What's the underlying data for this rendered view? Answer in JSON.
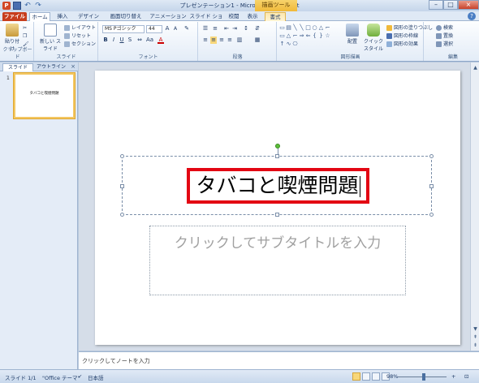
{
  "window": {
    "title": "プレゼンテーション1 - Microsoft PowerPoint",
    "context_tab_title": "描画ツール",
    "help": "?"
  },
  "qat": {
    "app_icon": "P",
    "undo": "↶",
    "redo": "↷"
  },
  "tabs": {
    "file": "ファイル",
    "home": "ホーム",
    "insert": "挿入",
    "design": "デザイン",
    "transitions": "画面切り替え",
    "animations": "アニメーション",
    "slideshow": "スライド ショー",
    "review": "校閲",
    "view": "表示",
    "format": "書式"
  },
  "ribbon": {
    "clipboard": {
      "paste": "貼り付け",
      "label": "クリップボード"
    },
    "slides": {
      "new_slide": "新しい スライド",
      "layout": "レイアウト",
      "reset": "リセット",
      "section": "セクション",
      "label": "スライド"
    },
    "font": {
      "name": "MS Pゴシック",
      "size": "44",
      "bold": "B",
      "italic": "I",
      "underline": "U",
      "strike": "S",
      "grow": "A",
      "shrink": "A",
      "color": "A",
      "label": "フォント"
    },
    "paragraph": {
      "label": "段落"
    },
    "drawing": {
      "arrange": "配置",
      "quick_styles": "クイック スタイル",
      "fill": "図形の塗りつぶし",
      "outline": "図形の枠線",
      "effects": "図形の効果",
      "label": "図形描画"
    },
    "editing": {
      "find": "検索",
      "replace": "置換",
      "select": "選択",
      "label": "編集"
    }
  },
  "left_pane": {
    "tab_slides": "スライド",
    "tab_outline": "アウトライン",
    "close": "×",
    "slide_number": "1",
    "thumb_title": "タバコと喫煙問題"
  },
  "slide": {
    "title": "タバコと喫煙問題",
    "subtitle_placeholder": "クリックしてサブタイトルを入力"
  },
  "notes": {
    "placeholder": "クリックしてノートを入力"
  },
  "status": {
    "slide_info": "スライド 1/1",
    "theme": "\"Office テーマ\"",
    "language": "日本語",
    "zoom": "98%"
  },
  "colors": {
    "file_tab": "#c73e1d",
    "highlight": "#e30613",
    "context_tab": "#f0b93a"
  }
}
